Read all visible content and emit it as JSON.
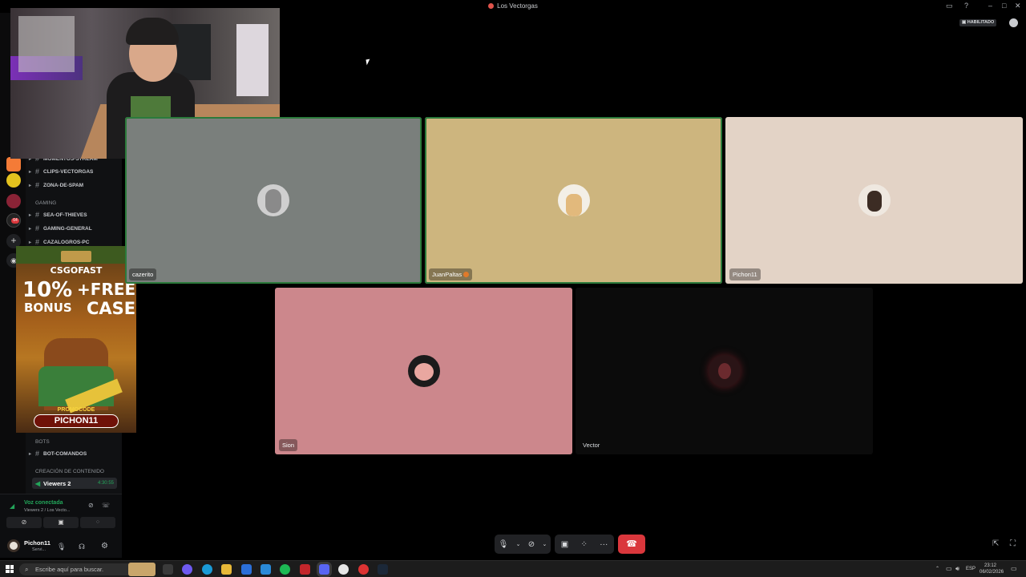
{
  "window": {
    "title": "Los Vectorgas"
  },
  "top_right": {
    "badge": "HABILITADO"
  },
  "channels": {
    "rows": [
      {
        "label": "MOMENTOS-STREAM"
      },
      {
        "label": "CLIPS-VECTORGAS"
      },
      {
        "label": "ZONA-DE-SPAM"
      },
      {
        "label": "SEA-OF-THIEVES"
      },
      {
        "label": "GAMING-GENERAL"
      },
      {
        "label": "CAZALOGROS-PC"
      },
      {
        "label": "BOT-COMANDOS"
      }
    ],
    "categories": [
      "GAMING",
      "BOTS",
      "CREACIÓN DE CONTENIDO"
    ],
    "voice_channel": {
      "name": "Viewers 2",
      "duration": "4:30:55"
    }
  },
  "voice_panel": {
    "status": "Voz conectada",
    "location": "Viewers 2 / Los Vecto...",
    "username": "Pichon11",
    "user_status": "Servi..."
  },
  "ad": {
    "brand": "CSGOFAST",
    "percent": "10%",
    "bonus": "BONUS",
    "free": "+FREE",
    "case": "CASE",
    "promo_label": "PROMOCODE",
    "promo_code": "PICHON11"
  },
  "participants": [
    {
      "name": "cazerito",
      "color": "#7a7f7c",
      "speaking": true
    },
    {
      "name": "JuanPaltas",
      "color": "#cdb57e",
      "speaking": true
    },
    {
      "name": "Pichon11",
      "color": "#e3d3c6",
      "speaking": false
    },
    {
      "name": "Sion",
      "color": "#cc878c",
      "speaking": false
    },
    {
      "name": "Vector",
      "color": "#0b0b0b",
      "speaking": false
    }
  ],
  "taskbar": {
    "search_placeholder": "Escribe aquí para buscar.",
    "language": "ESP",
    "time": "23:12",
    "date": "06/02/2026"
  }
}
